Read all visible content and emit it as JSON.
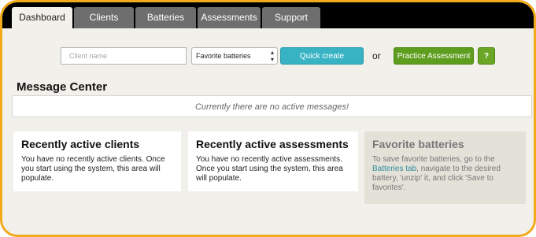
{
  "tabs": [
    {
      "label": "Dashboard",
      "active": true
    },
    {
      "label": "Clients"
    },
    {
      "label": "Batteries"
    },
    {
      "label": "Assessments"
    },
    {
      "label": "Support"
    }
  ],
  "toolbar": {
    "client_placeholder": "Client name",
    "battery_select_value": "Favorite batteries",
    "quick_create_label": "Quick create",
    "or_text": "or",
    "practice_label": "Practice Assessment",
    "help_label": "?"
  },
  "message_center": {
    "title": "Message Center",
    "empty_text": "Currently there are no active messages!"
  },
  "cards": {
    "clients": {
      "title": "Recently active clients",
      "body": "You have no recently active clients. Once you start using the system, this area will populate."
    },
    "assessments": {
      "title": "Recently active assessments",
      "body": "You have no recently active assessments. Once you start using the system, this area will populate."
    },
    "favorites": {
      "title": "Favorite batteries",
      "body_pre": "To save favorite batteries, go to the ",
      "link_text": "Batteries tab",
      "body_post": ", navigate to the desired battery, 'unzip' it, and click 'Save to favorites'."
    }
  },
  "colors": {
    "frame_border": "#f2a91a",
    "quick_create": "#38b3c4",
    "practice": "#5e9e1e",
    "link": "#2f8c99"
  }
}
